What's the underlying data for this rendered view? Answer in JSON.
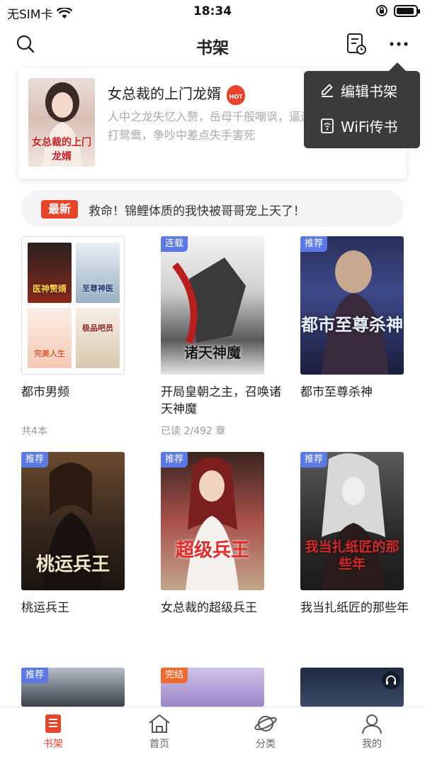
{
  "status_bar": {
    "carrier": "无SIM卡",
    "time": "18:34"
  },
  "nav": {
    "title": "书架"
  },
  "featured": {
    "title": "女总裁的上门龙婿",
    "badge": "HOT",
    "description": "人中之龙失忆入赘，岳母千般嘲讽，逼迫，棒打鸳鸯，争吵中差点失手害死",
    "cover_text": "女总裁的上门龙婿"
  },
  "popup": {
    "items": [
      "编辑书架",
      "WiFi传书"
    ]
  },
  "notice": {
    "badge": "最新",
    "text": "救命！锦鲤体质的我快被哥哥宠上天了！"
  },
  "folder": {
    "title": "都市男频",
    "meta": "共4本",
    "covers": [
      "医神赘婿",
      "至尊神医",
      "完美人生",
      "极品吧员"
    ]
  },
  "books": [
    {
      "title": "开局皇朝之主，召唤诸天神魔",
      "tag": "连载",
      "meta": "已读 2/492 章",
      "cover_text": "诸天神魔",
      "tag_color": "#5b79e6"
    },
    {
      "title": "都市至尊杀神",
      "tag": "推荐",
      "meta": "",
      "cover_text": "都市至尊杀神",
      "tag_color": "#5b79e6"
    },
    {
      "title": "桃运兵王",
      "tag": "推荐",
      "meta": "",
      "cover_text": "桃运兵王",
      "tag_color": "#5b79e6"
    },
    {
      "title": "女总裁的超级兵王",
      "tag": "推荐",
      "meta": "",
      "cover_text": "超级兵王",
      "tag_color": "#5b79e6"
    },
    {
      "title": "我当扎纸匠的那些年",
      "tag": "推荐",
      "meta": "",
      "cover_text": "我当扎纸匠的那些年",
      "tag_color": "#5b79e6"
    }
  ],
  "partial_books": [
    {
      "tag": "推荐",
      "tag_color": "#5b79e6"
    },
    {
      "tag": "完结",
      "tag_color": "#ef6a2c"
    },
    {
      "tag": "",
      "tag_color": ""
    }
  ],
  "tabs": [
    {
      "label": "书架",
      "icon": "bookshelf-icon",
      "active": true
    },
    {
      "label": "首页",
      "icon": "home-icon",
      "active": false
    },
    {
      "label": "分类",
      "icon": "planet-icon",
      "active": false
    },
    {
      "label": "我的",
      "icon": "profile-icon",
      "active": false
    }
  ],
  "colors": {
    "accent": "#e8432b",
    "popup_bg": "#3b3b3b",
    "tag_blue": "#5b79e6",
    "tag_orange": "#ef6a2c"
  }
}
